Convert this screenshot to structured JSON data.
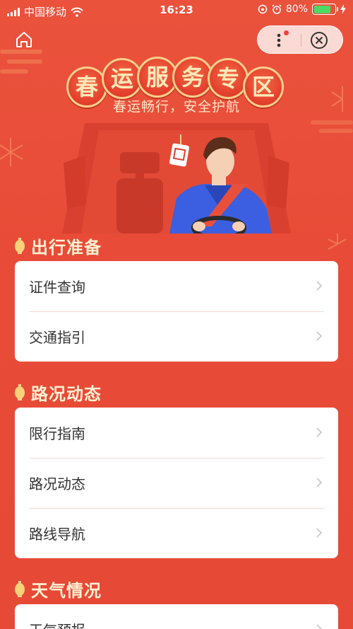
{
  "status_bar": {
    "carrier": "中国移动",
    "time": "16:23",
    "battery_percent": "80%",
    "battery_level": 0.8
  },
  "banner": {
    "title_chars": [
      "春",
      "运",
      "服",
      "务",
      "专",
      "区"
    ],
    "subtitle": "春运畅行，安全护航"
  },
  "sections": [
    {
      "title": "出行准备",
      "items": [
        "证件查询",
        "交通指引"
      ]
    },
    {
      "title": "路况动态",
      "items": [
        "限行指南",
        "路况动态",
        "路线导航"
      ]
    },
    {
      "title": "天气情况",
      "items": [
        "天气预报"
      ]
    }
  ],
  "colors": {
    "background": "#e8503b",
    "section_title": "#fff1d2",
    "card": "#ffffff",
    "battery": "#4cd964"
  },
  "icons": [
    "home-icon",
    "more-icon",
    "close-icon",
    "chevron-right-icon",
    "lantern-icon",
    "wifi-icon",
    "signal-icon",
    "alarm-icon"
  ]
}
